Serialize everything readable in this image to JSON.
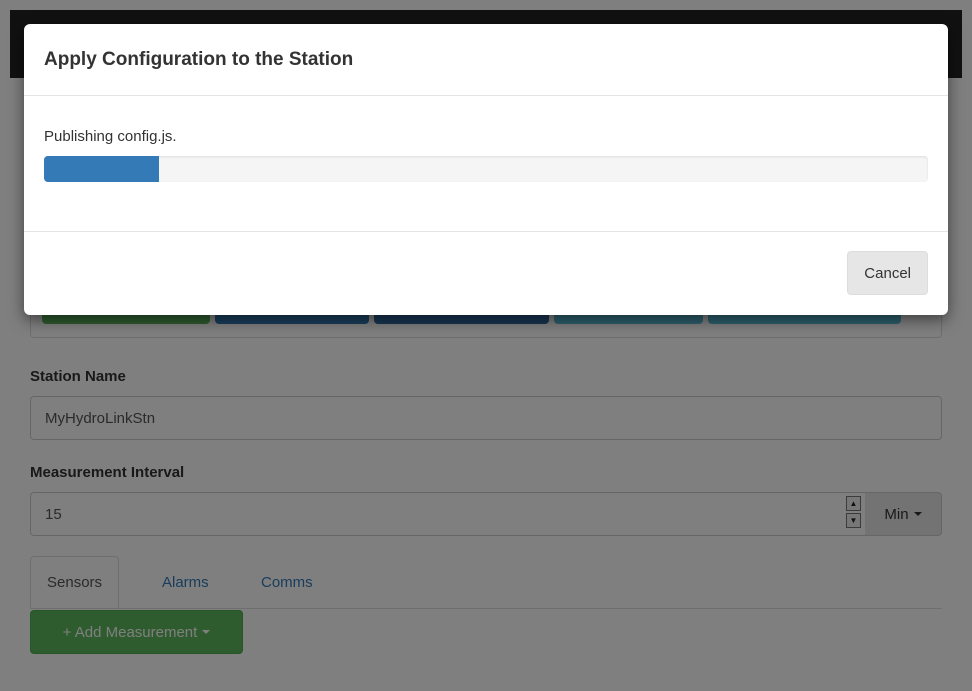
{
  "form": {
    "station_name_label": "Station Name",
    "station_name_value": "MyHydroLinkStn",
    "interval_label": "Measurement Interval",
    "interval_value": "15",
    "interval_unit": "Min"
  },
  "tabs": [
    {
      "label": "Sensors",
      "active": true
    },
    {
      "label": "Alarms",
      "active": false
    },
    {
      "label": "Comms",
      "active": false
    }
  ],
  "add_measurement_label": "+ Add Measurement",
  "icons": {
    "spinner_up": "up-arrow-icon",
    "spinner_down": "down-arrow-icon",
    "caret": "caret-down-icon"
  },
  "modal": {
    "title": "Apply Configuration to the Station",
    "status": "Publishing config.js.",
    "progress": 0.13,
    "cancel_label": "Cancel"
  },
  "colors": {
    "navbar": "#222222",
    "primary": "#337ab7",
    "success": "#5cb85c",
    "info": "#5bc0de"
  }
}
